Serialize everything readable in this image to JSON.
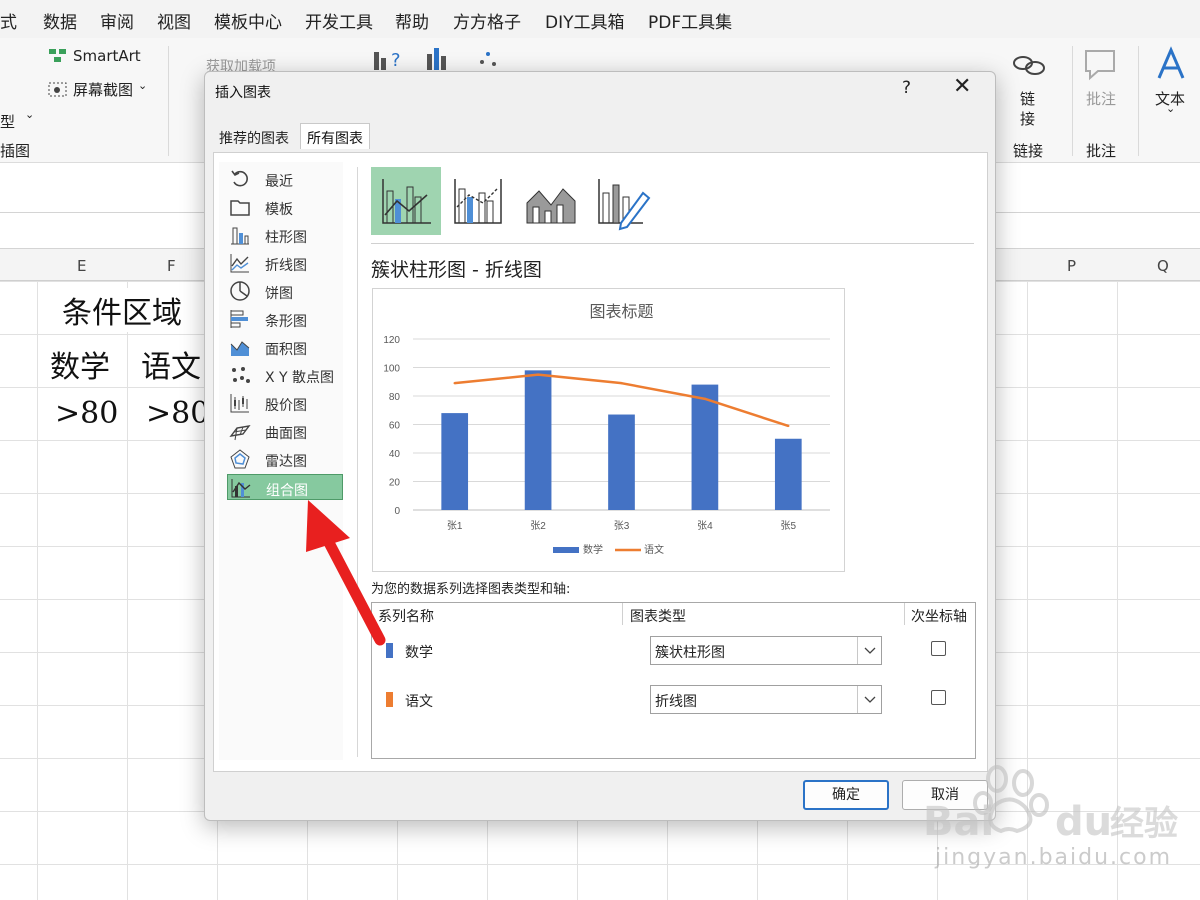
{
  "menu": {
    "items": [
      "式",
      "数据",
      "审阅",
      "视图",
      "模板中心",
      "开发工具",
      "帮助",
      "方方格子",
      "DIY工具箱",
      "PDF工具集"
    ]
  },
  "ribbon": {
    "smartart_label": "SmartArt",
    "screenshot_label": "屏幕截图",
    "type_fragment": "型",
    "illustrations_group": "插图",
    "addins_label": "获取加载项",
    "link_label_1": "链",
    "link_label_2": "接",
    "link_group": "链接",
    "comment_label": "批注",
    "comment_group": "批注",
    "text_label": "文本"
  },
  "sheet": {
    "columns": [
      "E",
      "F",
      "P",
      "Q"
    ],
    "title_cell": "条件区域",
    "header_math": "数学",
    "header_chinese": "语文",
    "crit_math": ">80",
    "crit_chinese": ">80"
  },
  "dialog": {
    "title": "插入图表",
    "help": "?",
    "close": "✕",
    "tabs": {
      "recommended": "推荐的图表",
      "all": "所有图表"
    },
    "categories": [
      {
        "label": "最近",
        "icon": "recent-icon"
      },
      {
        "label": "模板",
        "icon": "template-icon"
      },
      {
        "label": "柱形图",
        "icon": "column-chart-icon"
      },
      {
        "label": "折线图",
        "icon": "line-chart-icon"
      },
      {
        "label": "饼图",
        "icon": "pie-chart-icon"
      },
      {
        "label": "条形图",
        "icon": "bar-chart-icon"
      },
      {
        "label": "面积图",
        "icon": "area-chart-icon"
      },
      {
        "label": "X Y 散点图",
        "icon": "scatter-chart-icon"
      },
      {
        "label": "股价图",
        "icon": "stock-chart-icon"
      },
      {
        "label": "曲面图",
        "icon": "surface-chart-icon"
      },
      {
        "label": "雷达图",
        "icon": "radar-chart-icon"
      },
      {
        "label": "组合图",
        "icon": "combo-chart-icon"
      }
    ],
    "selected_category": "组合图",
    "combo_title": "簇状柱形图 - 折线图",
    "series_prompt": "为您的数据系列选择图表类型和轴:",
    "series_headers": {
      "name": "系列名称",
      "type": "图表类型",
      "secondary": "次坐标轴"
    },
    "series": [
      {
        "name": "数学",
        "type": "簇状柱形图",
        "color": "#4472c4",
        "secondary_axis": false
      },
      {
        "name": "语文",
        "type": "折线图",
        "color": "#ed7d31",
        "secondary_axis": false
      }
    ],
    "ok": "确定",
    "cancel": "取消"
  },
  "chart_data": {
    "type": "bar",
    "title": "图表标题",
    "categories": [
      "张1",
      "张2",
      "张3",
      "张4",
      "张5"
    ],
    "series": [
      {
        "name": "数学",
        "type": "bar",
        "color": "#4472c4",
        "values": [
          68,
          98,
          67,
          88,
          50
        ]
      },
      {
        "name": "语文",
        "type": "line",
        "color": "#ed7d31",
        "values": [
          89,
          95,
          89,
          78,
          59
        ]
      }
    ],
    "ylim": [
      0,
      120
    ],
    "yticks": [
      0,
      20,
      40,
      60,
      80,
      100,
      120
    ],
    "grid": true,
    "legend": "bottom"
  },
  "watermark": {
    "brand": "Bai",
    "brand2": "du",
    "cn": "经验",
    "url": "jingyan.baidu.com"
  },
  "colors": {
    "accent_green": "#86c99f",
    "subtype_selected": "#9fd4b0",
    "arrow_red": "#e8201f",
    "ok_border": "#2b73c7"
  }
}
